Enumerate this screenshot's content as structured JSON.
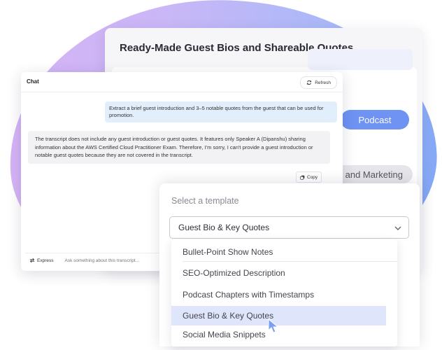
{
  "back_card": {
    "title": "Ready-Made Guest Bios and Shareable Quotes",
    "podcast_label": "Podcast",
    "marketing_label": "and Marketing"
  },
  "chat": {
    "title": "Chat",
    "refresh_label": "Refresh",
    "user_message": "Extract a brief guest introduction and 3–5 notable quotes from the guest that can be used for promotion.",
    "bot_message": "The transcript does not include any guest introduction or guest quotes. It features only Speaker A (Dipanshu) sharing information about the AWS Certified Cloud Practitioner Exam. Therefore, I'm sorry, I can't provide a guest introduction or notable guest quotes because they are not covered in the transcript.",
    "copy_label": "Copy",
    "mode_label": "Express",
    "input_placeholder": "Ask something about this transcript..."
  },
  "template": {
    "label": "Select a template",
    "selected_value": "Guest Bio & Key Quotes",
    "options": [
      "Bullet-Point Show Notes",
      "SEO-Optimized Description",
      "Podcast Chapters with Timestamps",
      "Guest Bio & Key Quotes",
      "Social Media Snippets"
    ],
    "highlighted_index": 3
  },
  "colors": {
    "accent": "#6e93f3",
    "highlight": "#dfe6fb",
    "user_bubble": "#e3eefc"
  }
}
